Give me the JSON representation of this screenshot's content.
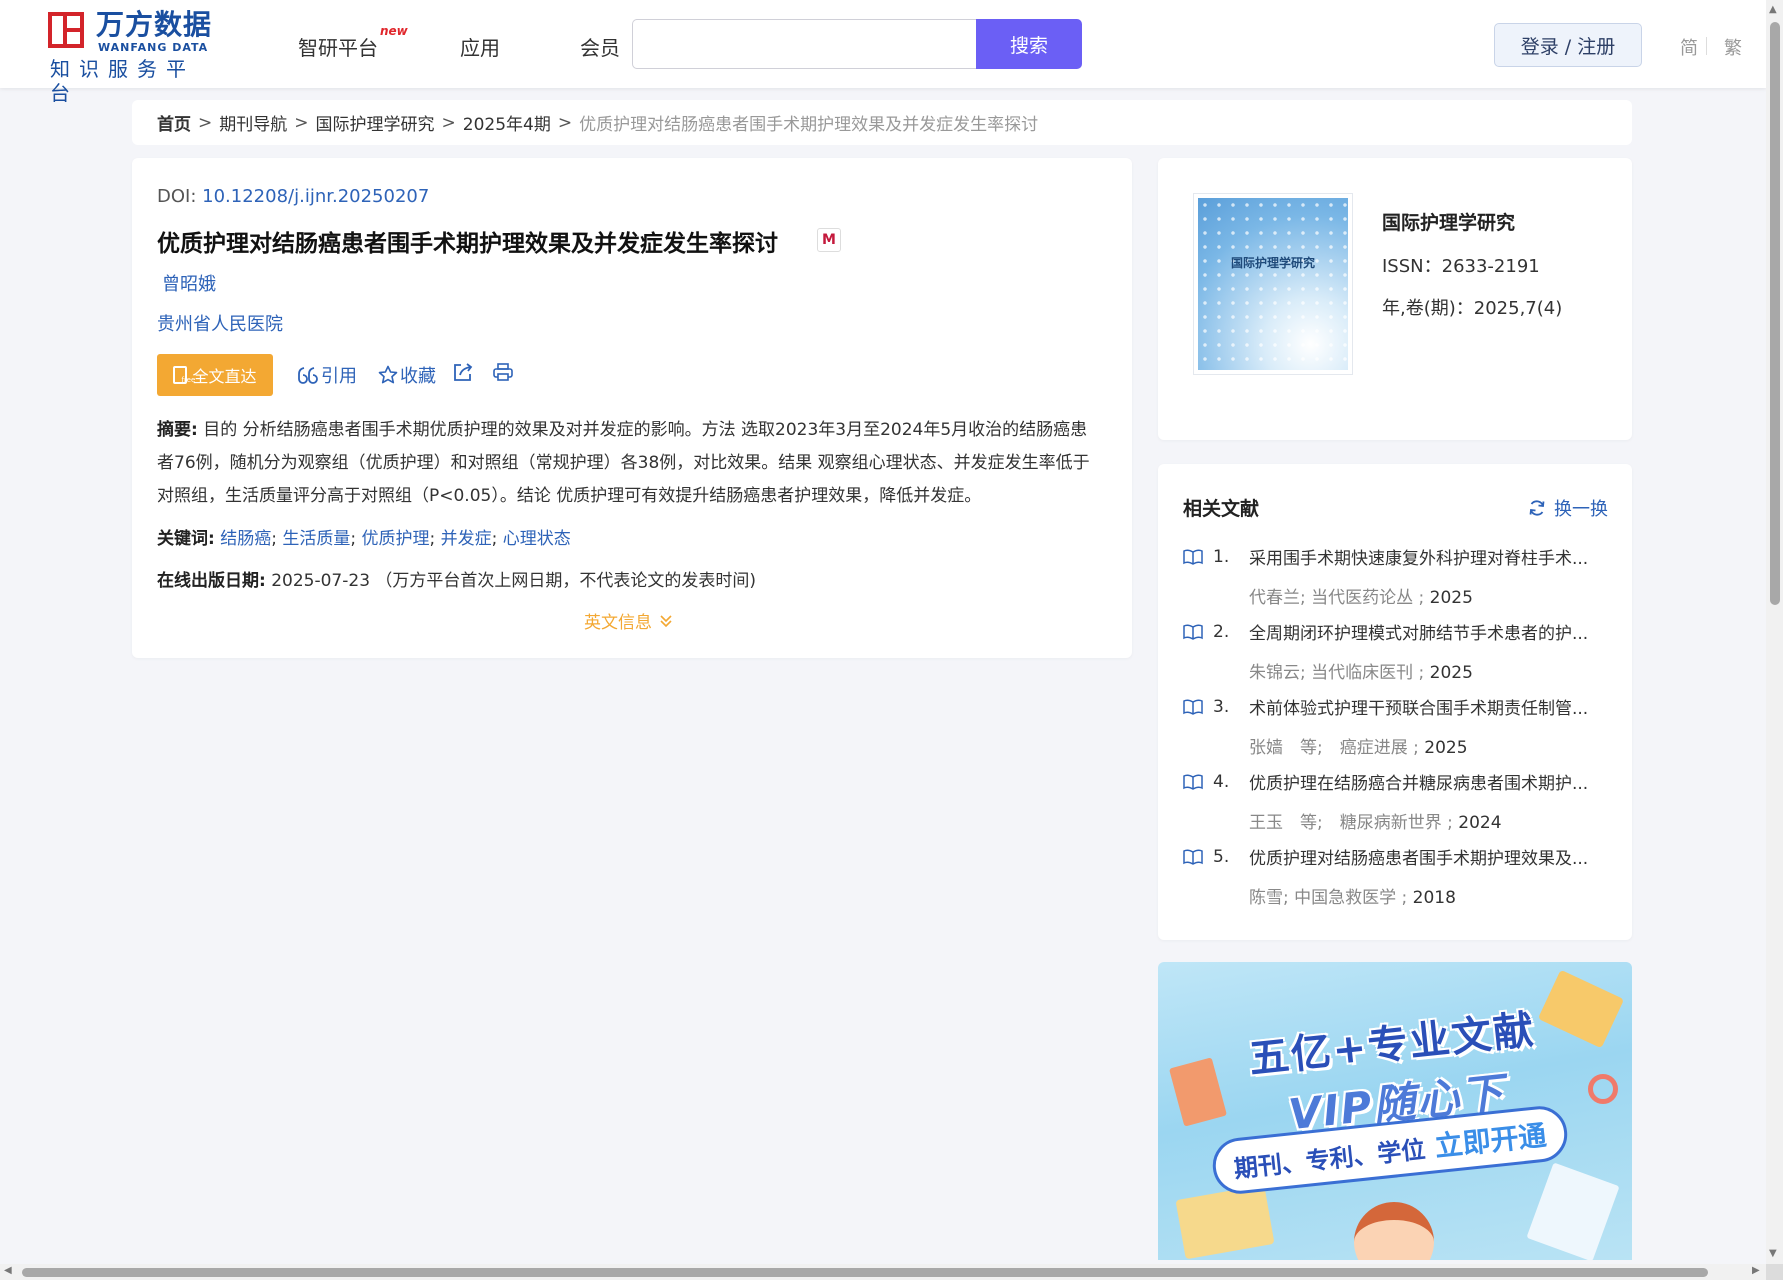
{
  "header": {
    "logo_cn": "万方数据",
    "logo_en": "WANFANG DATA",
    "logo_sub": "知识服务平台",
    "nav": [
      "智研平台",
      "应用",
      "会员"
    ],
    "nav_new_badge": "new",
    "search_placeholder": "",
    "search_button": "搜索",
    "login": "登录 / 注册",
    "lang_simplified": "简",
    "lang_traditional": "繁"
  },
  "breadcrumb": {
    "items": [
      "首页",
      "期刊导航",
      "国际护理学研究",
      "2025年4期"
    ],
    "separator": ">",
    "current": "优质护理对结肠癌患者围手术期护理效果及并发症发生率探讨"
  },
  "article": {
    "doi_label": "DOI:",
    "doi": "10.12208/j.ijnr.20250207",
    "title": "优质护理对结肠癌患者围手术期护理效果及并发症发生率探讨",
    "author": "曾昭娥",
    "organization": "贵州省人民医院",
    "fulltext_button": "全文直达",
    "actions": {
      "cite": "引用",
      "collect": "收藏"
    },
    "abstract_label": "摘要:",
    "abstract": "目的 分析结肠癌患者围手术期优质护理的效果及对并发症的影响。方法 选取2023年3月至2024年5月收治的结肠癌患者76例，随机分为观察组（优质护理）和对照组（常规护理）各38例，对比效果。结果 观察组心理状态、并发症发生率低于对照组，生活质量评分高于对照组（P<0.05）。结论 优质护理可有效提升结肠癌患者护理效果，降低并发症。",
    "keywords_label": "关键词:",
    "keywords": [
      "结肠癌",
      "生活质量",
      "优质护理",
      "并发症",
      "心理状态"
    ],
    "pubdate_label": "在线出版日期:",
    "pubdate": "2025-07-23",
    "pubdate_note": "（万方平台首次上网日期，不代表论文的发表时间)",
    "english_info": "英文信息"
  },
  "journal": {
    "cover_title": "国际护理学研究",
    "name": "国际护理学研究",
    "issn": "ISSN：2633-2191",
    "volume": "年,卷(期)：2025,7(4)"
  },
  "related": {
    "heading": "相关文献",
    "refresh": "换一换",
    "items": [
      {
        "num": "1.",
        "title": "采用围手术期快速康复外科护理对脊柱手术...",
        "meta": "代春兰; 当代医药论丛 ;",
        "year": "2025"
      },
      {
        "num": "2.",
        "title": "全周期闭环护理模式对肺结节手术患者的护...",
        "meta": "朱锦云; 当代临床医刊 ;",
        "year": "2025"
      },
      {
        "num": "3.",
        "title": "术前体验式护理干预联合围手术期责任制管...",
        "meta": "张嫱　等;　癌症进展 ;",
        "year": "2025"
      },
      {
        "num": "4.",
        "title": "优质护理在结肠癌合并糖尿病患者围术期护...",
        "meta": "王玉　等;　糖尿病新世界 ;",
        "year": "2024"
      },
      {
        "num": "5.",
        "title": "优质护理对结肠癌患者围手术期护理效果及...",
        "meta": "陈雪; 中国急救医学 ;",
        "year": "2018"
      }
    ]
  },
  "banner": {
    "line1": "五亿+专业文献",
    "line2": "VIP随心下",
    "pill_text": "期刊、专利、学位",
    "pill_highlight": "立即开通"
  },
  "colors": {
    "accent": "#6b5ff5",
    "link": "#2e63b8",
    "orange": "#f3a833",
    "brand_red": "#d3242a",
    "brand_blue": "#1a4fa0"
  }
}
